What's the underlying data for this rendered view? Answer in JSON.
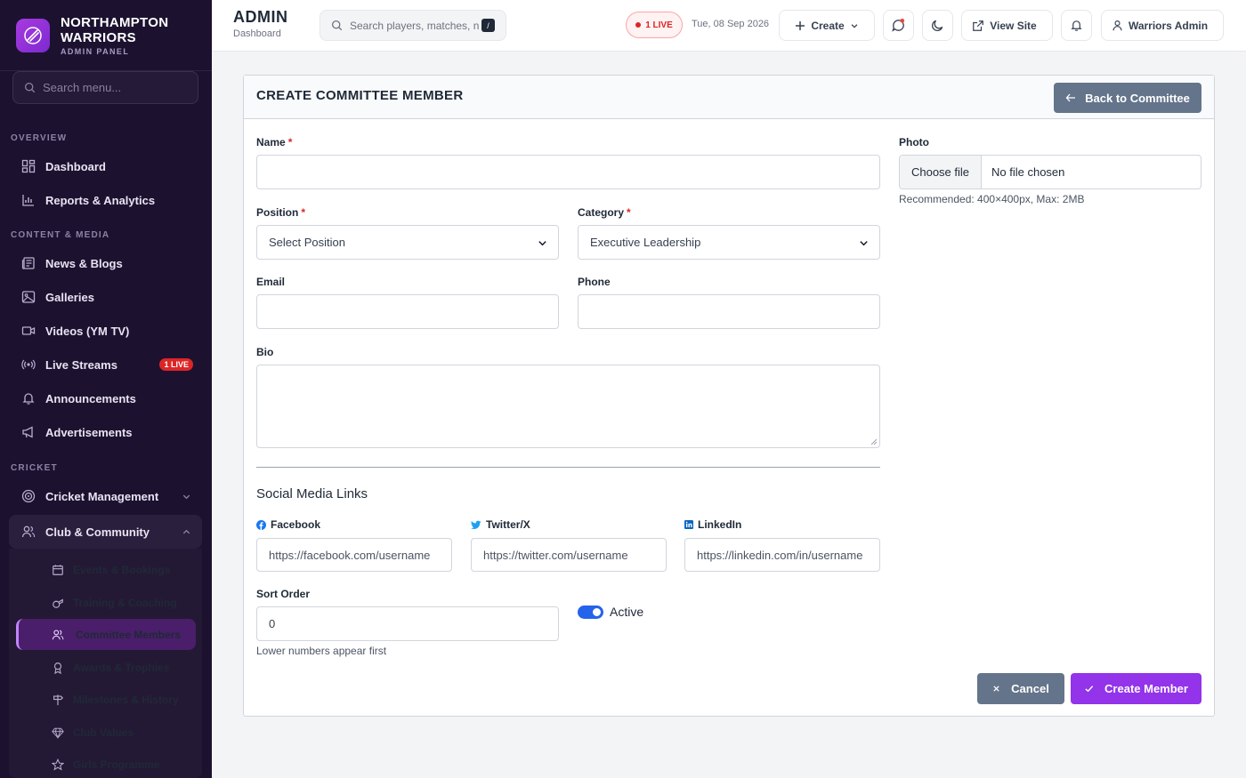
{
  "brand": {
    "name_line1": "NORTHAMPTON",
    "name_line2": "WARRIORS",
    "sub": "ADMIN PANEL"
  },
  "sidebar": {
    "search_placeholder": "Search menu...",
    "sections": {
      "overview": "OVERVIEW",
      "content": "CONTENT & MEDIA",
      "cricket": "CRICKET"
    },
    "items": {
      "dashboard": "Dashboard",
      "reports": "Reports & Analytics",
      "news": "News & Blogs",
      "galleries": "Galleries",
      "videos": "Videos (YM TV)",
      "live": "Live Streams",
      "live_badge": "1 LIVE",
      "announcements": "Announcements",
      "ads": "Advertisements",
      "cricket_mgmt": "Cricket Management",
      "club": "Club & Community"
    },
    "sub_items": {
      "events": "Events & Bookings",
      "training": "Training & Coaching",
      "committee": "Committee Members",
      "awards": "Awards & Trophies",
      "milestones": "Milestones & History",
      "values": "Club Values",
      "girls": "Girls Programme"
    }
  },
  "header": {
    "title": "ADMIN",
    "subtitle": "Dashboard",
    "search_placeholder": "Search players, matches, n",
    "kbd": "/",
    "live": "1 LIVE",
    "date": "Tue, 08 Sep 2026",
    "create": "Create",
    "view_site": "View Site",
    "user": "Warriors Admin"
  },
  "form": {
    "title": "CREATE COMMITTEE MEMBER",
    "back": "Back to Committee",
    "name_label": "Name",
    "required": "*",
    "photo_label": "Photo",
    "choose_file": "Choose file",
    "no_file": "No file chosen",
    "photo_help": "Recommended: 400×400px, Max: 2MB",
    "position_label": "Position",
    "position_value": "Select Position",
    "category_label": "Category",
    "category_value": "Executive Leadership",
    "email_label": "Email",
    "phone_label": "Phone",
    "bio_label": "Bio",
    "social_title": "Social Media Links",
    "facebook_label": "Facebook",
    "facebook_ph": "https://facebook.com/username",
    "twitter_label": "Twitter/X",
    "twitter_ph": "https://twitter.com/username",
    "linkedin_label": "LinkedIn",
    "linkedin_ph": "https://linkedin.com/in/username",
    "sort_label": "Sort Order",
    "sort_value": "0",
    "sort_help": "Lower numbers appear first",
    "active_label": "Active",
    "active": true,
    "cancel": "Cancel",
    "submit": "Create Member"
  }
}
